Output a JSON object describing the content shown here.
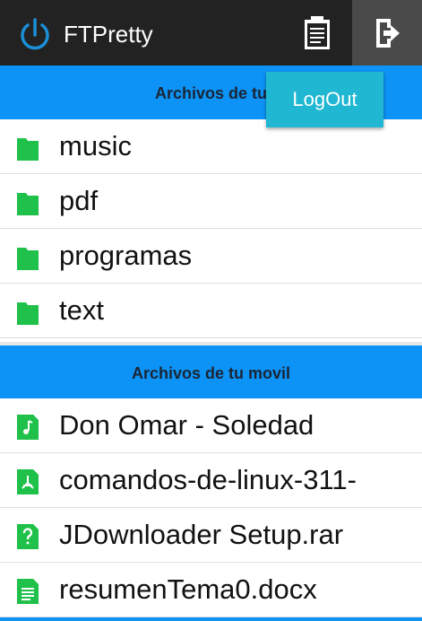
{
  "app": {
    "title": "FTPretty",
    "icon": "power-icon"
  },
  "toolbar": {
    "clipboard_icon": "clipboard-icon",
    "logout_icon": "logout-icon"
  },
  "popup": {
    "label": "LogOut"
  },
  "remote_section": {
    "header": "Archivos de tu",
    "items": [
      {
        "name": "music",
        "icon": "folder-icon"
      },
      {
        "name": "pdf",
        "icon": "folder-icon"
      },
      {
        "name": "programas",
        "icon": "folder-icon"
      },
      {
        "name": "text",
        "icon": "folder-icon"
      }
    ]
  },
  "local_section": {
    "header": "Archivos de tu movil",
    "items": [
      {
        "name": "Don Omar - Soledad",
        "icon": "audio-file-icon"
      },
      {
        "name": "comandos-de-linux-311-",
        "icon": "pdf-file-icon"
      },
      {
        "name": "JDownloader Setup.rar",
        "icon": "unknown-file-icon"
      },
      {
        "name": "resumenTema0.docx",
        "icon": "document-file-icon"
      }
    ]
  },
  "colors": {
    "accent": "#0c93f5",
    "actionbar": "#222222",
    "file_icon": "#1fc14a",
    "popup": "#1fb7d1"
  }
}
